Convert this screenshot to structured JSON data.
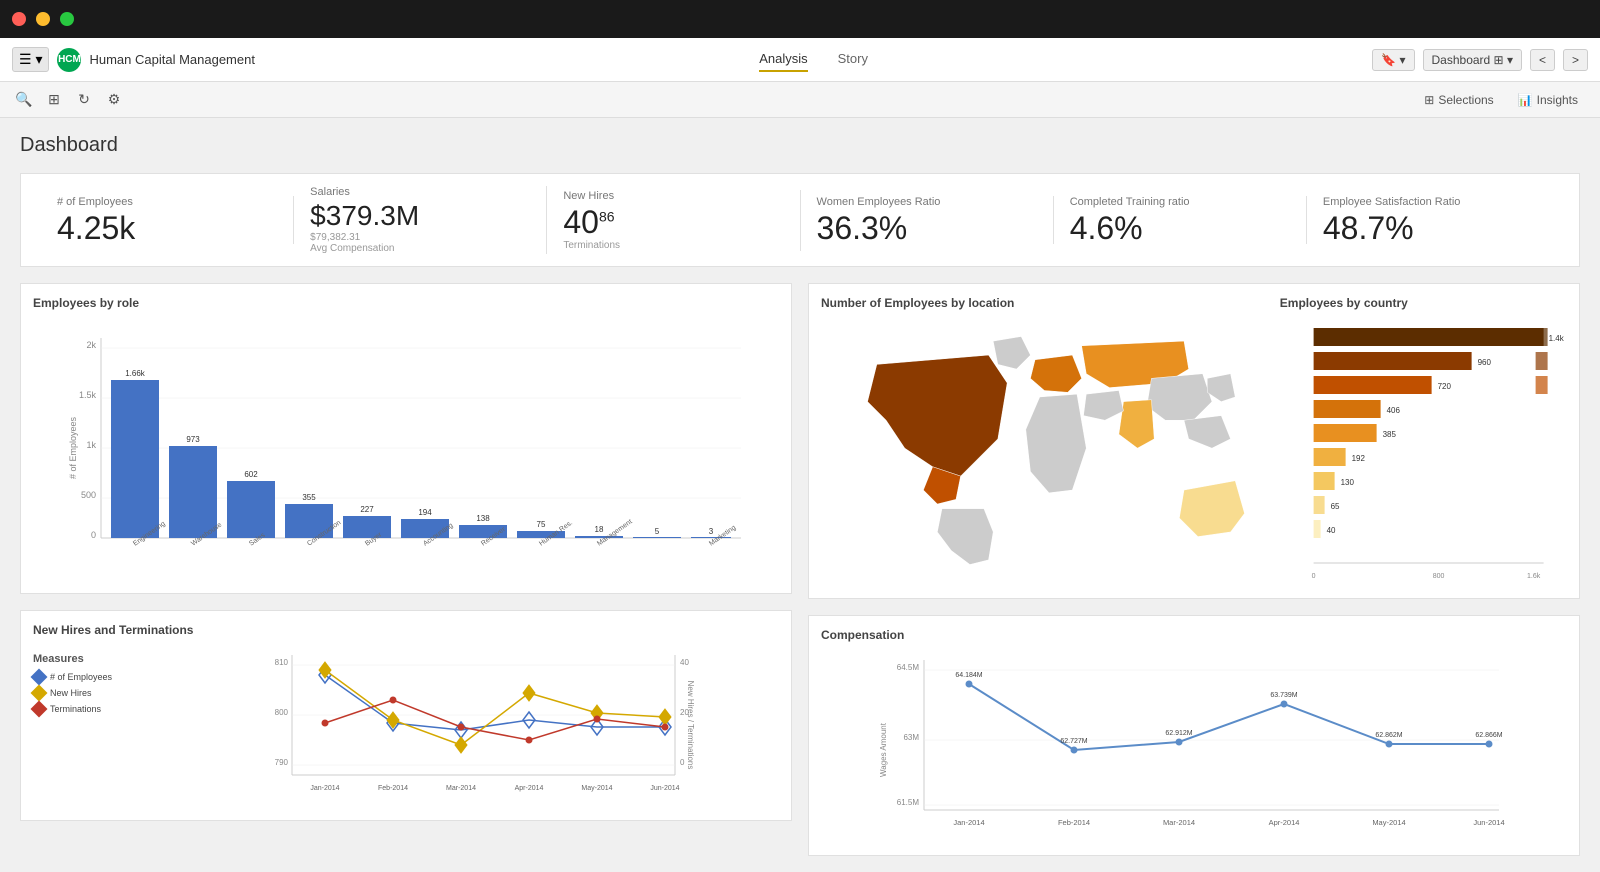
{
  "titlebar": {
    "dots": [
      "red",
      "yellow",
      "green"
    ]
  },
  "toolbar": {
    "app_name": "Human Capital Management",
    "tabs": [
      {
        "label": "Analysis",
        "active": true
      },
      {
        "label": "Story",
        "active": false
      }
    ],
    "bookmark_label": "🔖",
    "dashboard_label": "Dashboard ⊞ ▾",
    "nav_prev": "<",
    "nav_next": ">"
  },
  "toolbar2": {
    "selections_label": "Selections",
    "insights_label": "Insights"
  },
  "dashboard": {
    "title": "Dashboard",
    "kpis": [
      {
        "label": "# of Employees",
        "value": "4.25k",
        "sub": ""
      },
      {
        "label": "Salaries",
        "value": "$379.3M",
        "sub1": "$79,382.31",
        "sub2": "Avg Compensation"
      },
      {
        "label": "New Hires",
        "value": "40",
        "value_small": "86",
        "sub": "Terminations"
      },
      {
        "label": "Women Employees Ratio",
        "value": "36.3%"
      },
      {
        "label": "Completed Training ratio",
        "value": "4.6%"
      },
      {
        "label": "Employee Satisfaction Ratio",
        "value": "48.7%"
      }
    ],
    "employees_by_role": {
      "title": "Employees by role",
      "y_axis_label": "# of Employees",
      "y_ticks": [
        "2k",
        "1.5k",
        "1k",
        "500",
        "0"
      ],
      "bars": [
        {
          "label": "Engineering",
          "value": 1660,
          "display": "1.66k"
        },
        {
          "label": "Warehouse",
          "value": 973,
          "display": "973"
        },
        {
          "label": "Sales",
          "value": 602,
          "display": "602"
        },
        {
          "label": "Construction",
          "value": 355,
          "display": "355"
        },
        {
          "label": "Buyer",
          "value": 227,
          "display": "227"
        },
        {
          "label": "Accounting",
          "value": 194,
          "display": "194"
        },
        {
          "label": "Receiver",
          "value": 138,
          "display": "138"
        },
        {
          "label": "Human Res.",
          "value": 75,
          "display": "75"
        },
        {
          "label": "Management",
          "value": 18,
          "display": "18"
        },
        {
          "label": "",
          "value": 5,
          "display": "5"
        },
        {
          "label": "Marketing",
          "value": 3,
          "display": "3"
        }
      ]
    },
    "new_hires_terminations": {
      "title": "New Hires and Terminations",
      "measures_label": "Measures",
      "legend": [
        {
          "label": "# of Employees",
          "color": "#4472C4",
          "shape": "diamond"
        },
        {
          "label": "New Hires",
          "color": "#d4a800",
          "shape": "diamond"
        },
        {
          "label": "Terminations",
          "color": "#c0392b",
          "shape": "diamond"
        }
      ],
      "y_left_ticks": [
        "810",
        "800",
        "790"
      ],
      "y_right_ticks": [
        "40",
        "20",
        "0"
      ],
      "x_labels": [
        "Jan-2014",
        "Feb-2014",
        "Mar-2014",
        "Apr-2014",
        "May-2014",
        "Jun-2014"
      ]
    },
    "employees_by_location": {
      "title": "Number of Employees by location"
    },
    "employees_by_country": {
      "title": "Employees by country",
      "bars": [
        {
          "label": "",
          "value": 1400,
          "display": "1.4k",
          "color": "#5c2d00"
        },
        {
          "label": "",
          "value": 960,
          "display": "960",
          "color": "#8b3a00"
        },
        {
          "label": "",
          "value": 720,
          "display": "720",
          "color": "#c05000"
        },
        {
          "label": "",
          "value": 406,
          "display": "406",
          "color": "#d4720a"
        },
        {
          "label": "",
          "value": 385,
          "display": "385",
          "color": "#e89020"
        },
        {
          "label": "",
          "value": 192,
          "display": "192",
          "color": "#f0b040"
        },
        {
          "label": "",
          "value": 130,
          "display": "130",
          "color": "#f4c860"
        },
        {
          "label": "",
          "value": 65,
          "display": "65",
          "color": "#f8dc90"
        },
        {
          "label": "",
          "value": 40,
          "display": "40",
          "color": "#fcefc0"
        }
      ],
      "x_ticks": [
        "0",
        "800",
        "1.6k"
      ]
    },
    "compensation": {
      "title": "Compensation",
      "y_label": "Wages Amount",
      "y_ticks": [
        "64.5M",
        "63M",
        "61.5M"
      ],
      "x_labels": [
        "Jan-2014",
        "Feb-2014",
        "Mar-2014",
        "Apr-2014",
        "May-2014",
        "Jun-2014"
      ],
      "points": [
        {
          "x": "Jan-2014",
          "y": 64.184,
          "label": "64.184M"
        },
        {
          "x": "Feb-2014",
          "y": 62.727,
          "label": "62.727M"
        },
        {
          "x": "Mar-2014",
          "y": 62.912,
          "label": "62.912M"
        },
        {
          "x": "Apr-2014",
          "y": 63.739,
          "label": "63.739M"
        },
        {
          "x": "May-2014",
          "y": 62.862,
          "label": "62.862M"
        },
        {
          "x": "Jun-2014",
          "y": 62.866,
          "label": "62.866M"
        }
      ]
    }
  }
}
